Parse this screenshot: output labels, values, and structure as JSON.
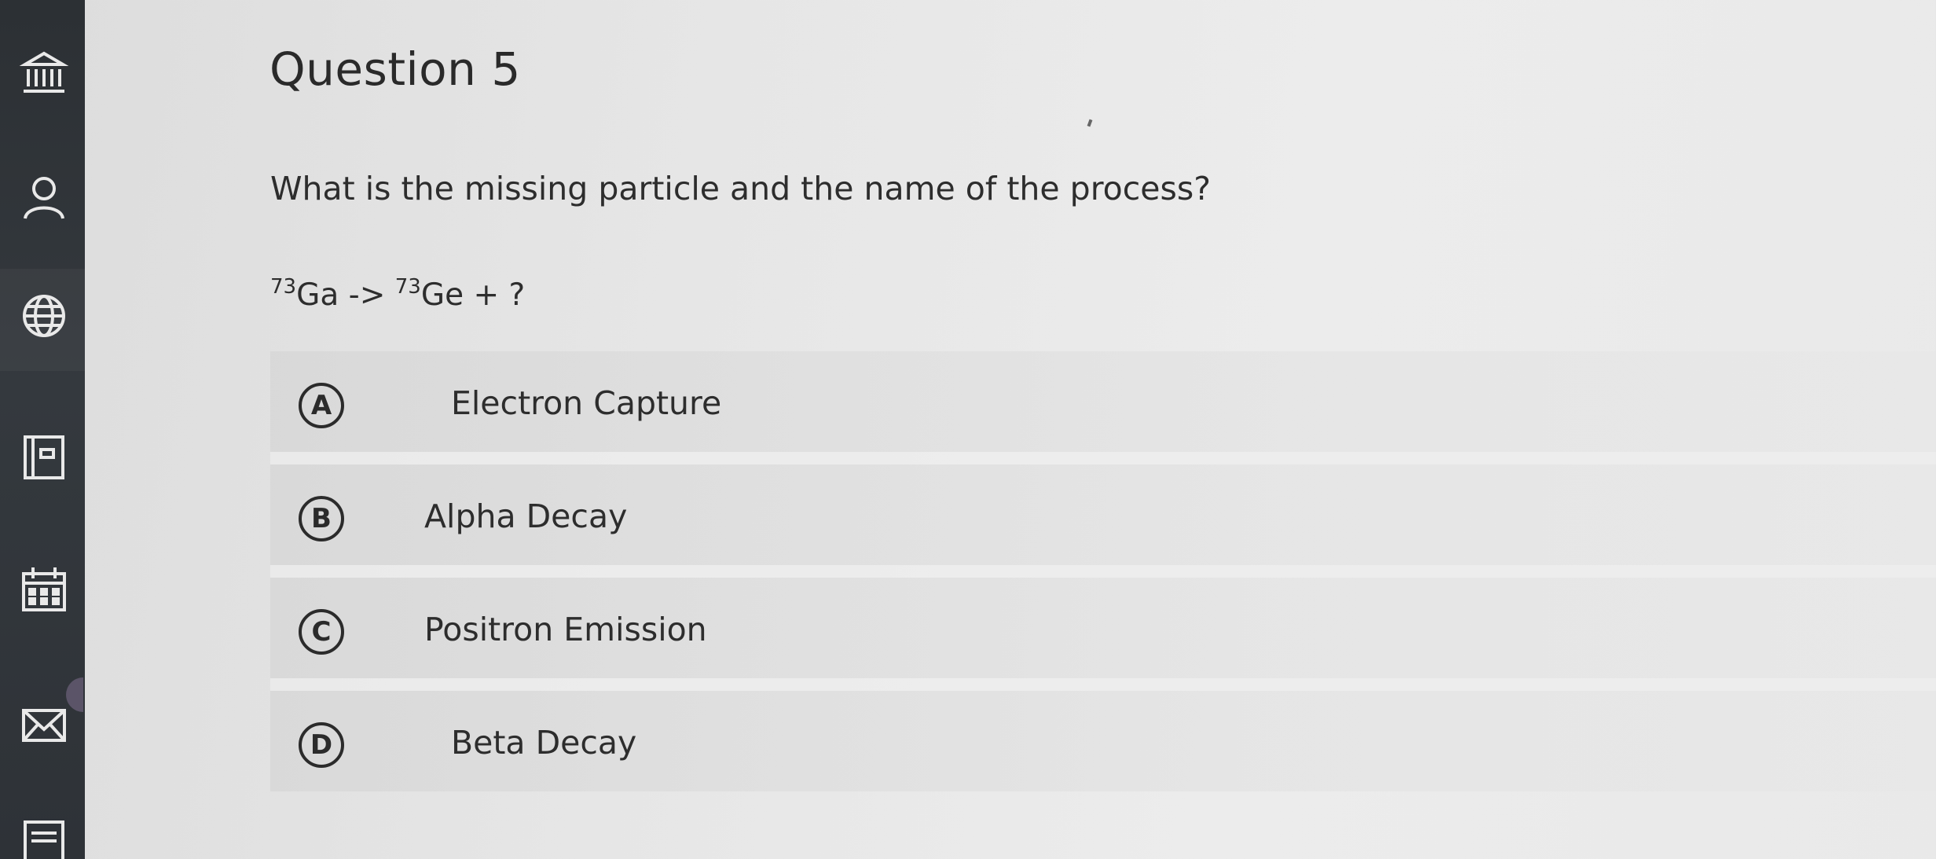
{
  "rail": {
    "icons": [
      "institution-icon",
      "account-icon",
      "globe-icon",
      "courses-icon",
      "calendar-icon",
      "inbox-icon",
      "history-icon"
    ]
  },
  "question": {
    "title": "Question 5",
    "prompt": "What is the missing particle and the name of the process?",
    "equation": {
      "reactant_mass": "73",
      "reactant": "Ga",
      "arrow": " -> ",
      "product_mass": "73",
      "product": "Ge",
      "tail": " + ?"
    }
  },
  "choices": [
    {
      "letter": "A",
      "label": "Electron Capture"
    },
    {
      "letter": "B",
      "label": "Alpha Decay"
    },
    {
      "letter": "C",
      "label": "Positron Emission"
    },
    {
      "letter": "D",
      "label": "Beta Decay"
    }
  ]
}
